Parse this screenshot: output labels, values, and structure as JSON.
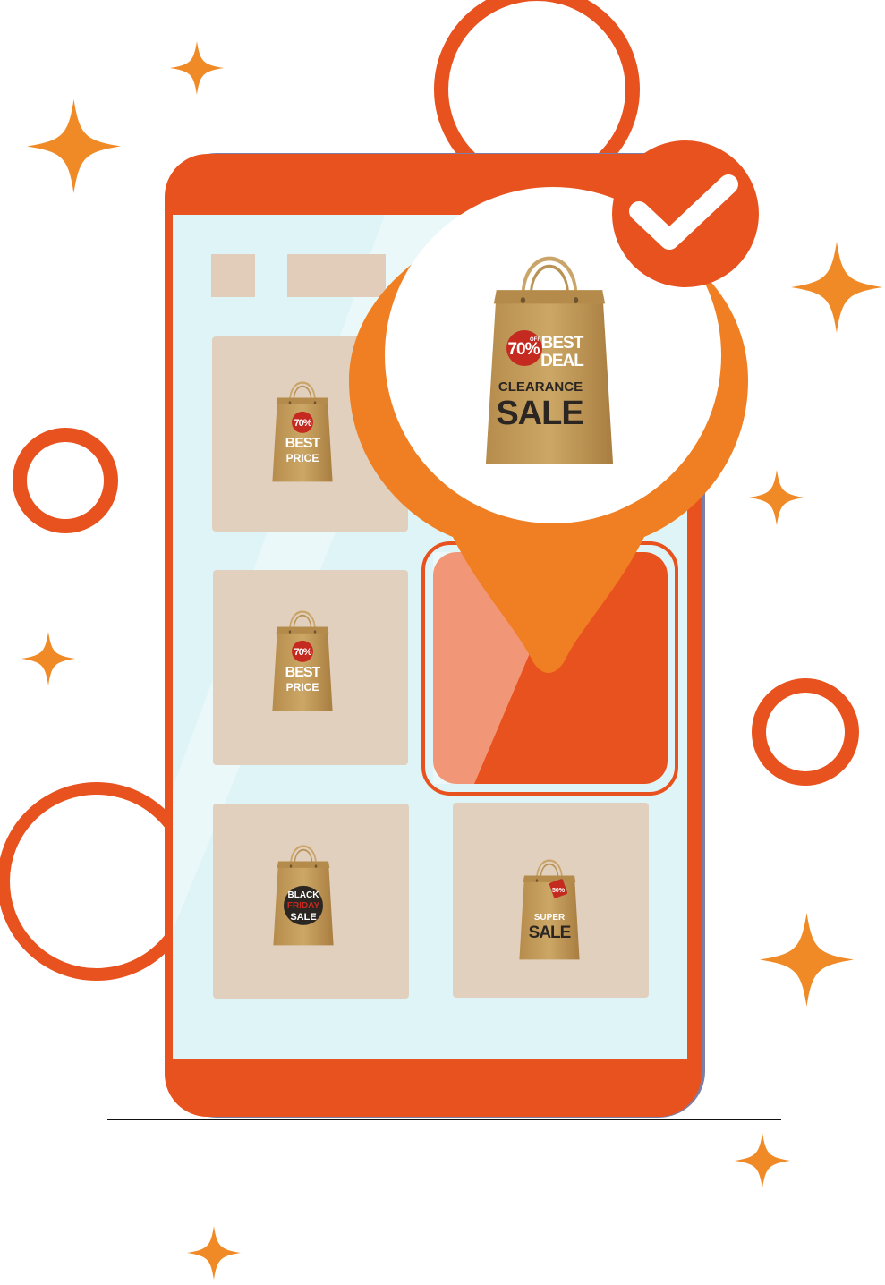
{
  "colors": {
    "brand": "#E8521E",
    "accent": "#F07E22",
    "sparkle": "#F08A26",
    "screen": "#DFF4F6",
    "tile": "#E2CDBB",
    "selected_tile": "#E8521E",
    "kraft": "#C6A160",
    "badge_red": "#C42A1F",
    "badge_dark": "#2B2622"
  },
  "highlight_bag": {
    "discount": "70%",
    "discount_small": "OFF",
    "line1": "BEST",
    "line2": "DEAL",
    "line3": "CLEARANCE",
    "line4": "SALE"
  },
  "tiles": [
    {
      "badge": "70%",
      "badge_small": "OFF",
      "line1": "BEST",
      "line2": "PRICE",
      "icon": "shopping-bag-icon"
    },
    {
      "badge": "70%",
      "badge_small": "OFF",
      "line1": "BEST",
      "line2": "PRICE",
      "icon": "shopping-bag-icon"
    },
    {
      "line1": "BLACK",
      "line2": "FRIDAY",
      "line3": "SALE",
      "icon": "shopping-bag-icon"
    },
    {
      "tag": "50%",
      "line1": "SUPER",
      "line2": "SALE",
      "icon": "shopping-bag-icon"
    }
  ],
  "icons": {
    "check": "check-icon",
    "pin": "map-pin-icon",
    "sparkle": "sparkle-icon",
    "ring": "ring-decoration"
  }
}
